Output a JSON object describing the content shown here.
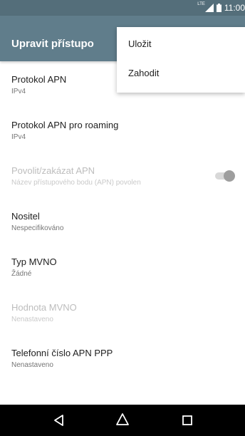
{
  "status_bar": {
    "network": "LTE",
    "time": "11:00",
    "icons": [
      "signal-icon",
      "battery-icon"
    ]
  },
  "toolbar": {
    "title": "Upravit přístupo"
  },
  "menu": {
    "items": [
      "Uložit",
      "Zahodit"
    ]
  },
  "settings": {
    "items": [
      {
        "title": "Protokol APN",
        "summary": "IPv4",
        "enabled": true
      },
      {
        "title": "Protokol APN pro roaming",
        "summary": "IPv4",
        "enabled": true
      },
      {
        "title": "Povolit/zakázat APN",
        "summary": "Název přístupového bodu (APN) povolen",
        "enabled": false,
        "toggle": "on"
      },
      {
        "title": "Nositel",
        "summary": "Nespecifikováno",
        "enabled": true
      },
      {
        "title": "Typ MVNO",
        "summary": "Žádné",
        "enabled": true
      },
      {
        "title": "Hodnota MVNO",
        "summary": "Nenastaveno",
        "enabled": false
      },
      {
        "title": "Telefonní číslo APN PPP",
        "summary": "Nenastaveno",
        "enabled": true
      }
    ]
  },
  "nav_bar": {
    "icons": [
      "back-icon",
      "home-icon",
      "recents-icon"
    ]
  },
  "colors": {
    "status_bar": "#546e7a",
    "toolbar": "#607d8b",
    "nav_bar": "#000000"
  }
}
